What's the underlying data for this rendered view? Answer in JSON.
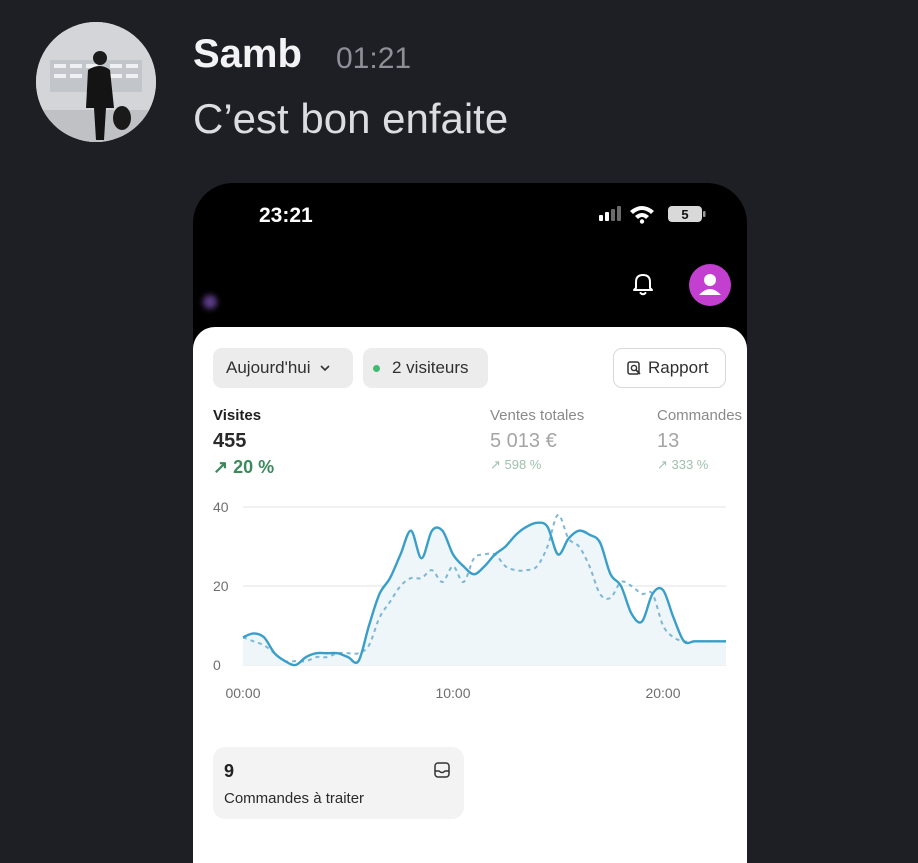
{
  "message": {
    "author": "Samb",
    "time": "01:21",
    "text": "C’est bon enfaite"
  },
  "phone": {
    "status": {
      "time": "23:21",
      "battery": "5"
    },
    "header": {
      "icons": [
        "bell-icon",
        "profile-icon"
      ],
      "profile_color": "#c23fd0"
    },
    "filters": {
      "date_label": "Aujourd'hui",
      "visitors_label": "2 visiteurs",
      "report_label": "Rapport"
    },
    "metrics": [
      {
        "label": "Visites",
        "value": "455",
        "delta": "↗ 20 %"
      },
      {
        "label": "Ventes totales",
        "value": "5 013 €",
        "delta": "↗ 598 %"
      },
      {
        "label": "Commandes",
        "value": "13",
        "delta": "↗ 333 %"
      }
    ],
    "orders_tile": {
      "count": "9",
      "label": "Commandes à traiter"
    }
  },
  "chart_data": {
    "type": "line",
    "title": "",
    "xlabel": "",
    "ylabel": "",
    "x_tick_labels": [
      "00:00",
      "10:00",
      "20:00"
    ],
    "y_tick_labels": [
      "40",
      "20",
      "0"
    ],
    "ylim": [
      0,
      40
    ],
    "xlim": [
      0,
      23
    ],
    "grid": true,
    "colors": {
      "today": "#3a9fc8",
      "comparison": "#7cb7d4",
      "fill": "#eef6fa"
    },
    "series": [
      {
        "style": "solid",
        "x": [
          0,
          0.5,
          1,
          1.5,
          2,
          2.5,
          3,
          3.5,
          4,
          4.5,
          5,
          5.5,
          6,
          6.5,
          7,
          7.5,
          8,
          8.5,
          9,
          9.5,
          10,
          10.5,
          11,
          11.5,
          12,
          12.5,
          13,
          13.5,
          14,
          14.5,
          15,
          15.5,
          16,
          16.5,
          17,
          17.5,
          18,
          18.5,
          19,
          19.5,
          20,
          20.5,
          21,
          21.5,
          22,
          22.5,
          23
        ],
        "values": [
          7,
          8,
          7,
          3,
          1,
          0,
          2,
          3,
          3,
          3,
          2,
          1,
          10,
          18,
          22,
          28,
          34,
          27,
          34,
          34,
          28,
          25,
          23,
          25,
          28,
          30,
          33,
          35,
          36,
          35,
          28,
          32,
          34,
          33,
          31,
          23,
          20,
          13,
          11,
          18,
          19,
          12,
          6,
          6,
          6,
          6,
          6
        ]
      },
      {
        "style": "dashed",
        "x": [
          0,
          0.5,
          1,
          1.5,
          2,
          2.5,
          3,
          3.5,
          4,
          4.5,
          5,
          5.5,
          6,
          6.5,
          7,
          7.5,
          8,
          8.5,
          9,
          9.5,
          10,
          10.5,
          11,
          11.5,
          12,
          12.5,
          13,
          13.5,
          14,
          14.5,
          15,
          15.5,
          16,
          16.5,
          17,
          17.5,
          18,
          18.5,
          19,
          19.5,
          20,
          20.5,
          21,
          21.5,
          22,
          22.5,
          23
        ],
        "values": [
          7,
          6,
          5,
          3,
          1,
          1,
          1,
          2,
          2,
          3,
          3,
          3,
          5,
          12,
          16,
          20,
          22,
          22,
          24,
          21,
          25,
          21,
          27,
          28,
          28,
          25,
          24,
          24,
          25,
          30,
          38,
          32,
          30,
          25,
          18,
          17,
          21,
          20,
          18,
          18,
          10,
          7,
          6,
          6,
          6,
          6,
          6
        ]
      }
    ]
  }
}
